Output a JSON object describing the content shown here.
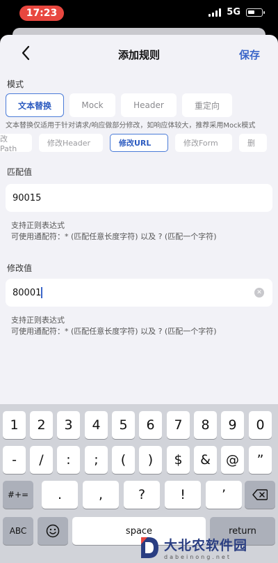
{
  "status_bar": {
    "time": "17:23",
    "network": "5G"
  },
  "nav": {
    "title": "添加规则",
    "save": "保存"
  },
  "mode_section": {
    "label": "模式",
    "options": [
      "文本替换",
      "Mock",
      "Header",
      "重定向"
    ],
    "description": "文本替换仅适用于针对请求/响应做部分修改，如响应体较大，推荐采用Mock模式"
  },
  "sub_tabs": [
    "改Path",
    "修改Header",
    "修改URL",
    "修改Form",
    "删"
  ],
  "match_field": {
    "label": "匹配值",
    "value": "90015",
    "hint_line1": "支持正则表达式",
    "hint_line2": "可使用通配符：* (匹配任意长度字符) 以及 ? (匹配一个字符)"
  },
  "modify_field": {
    "label": "修改值",
    "value": "80001",
    "hint_line1": "支持正则表达式",
    "hint_line2": "可使用通配符：* (匹配任意长度字符) 以及 ? (匹配一个字符)"
  },
  "keyboard": {
    "row1": [
      "1",
      "2",
      "3",
      "4",
      "5",
      "6",
      "7",
      "8",
      "9",
      "0"
    ],
    "row2": [
      "-",
      "/",
      ":",
      ";",
      "(",
      ")",
      "$",
      "&",
      "@",
      "”"
    ],
    "row3_left": "#+=",
    "row3": [
      ".",
      ",",
      "?",
      "!",
      "’"
    ],
    "abc": "ABC",
    "space": "space",
    "return": "return"
  },
  "watermark": {
    "cn": "大北农软件园",
    "en": "dabeinong.net"
  }
}
